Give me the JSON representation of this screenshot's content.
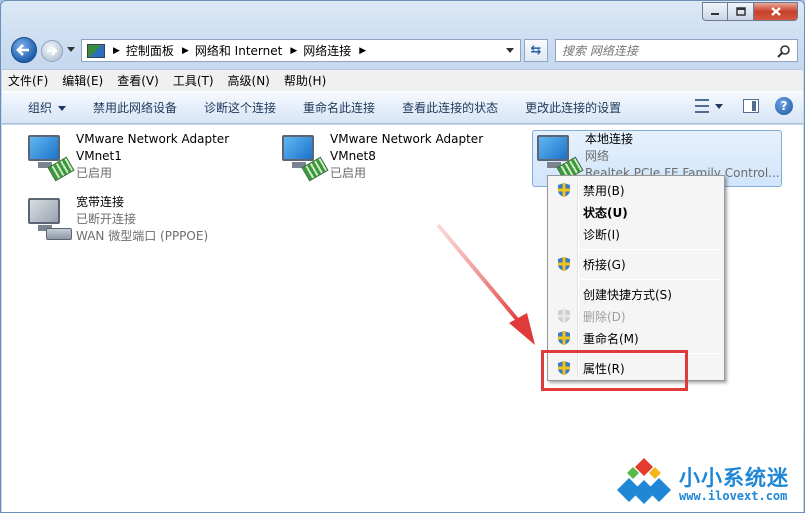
{
  "window": {
    "caption_buttons": [
      "minimize-icon",
      "maximize-icon",
      "close-icon"
    ]
  },
  "address": {
    "crumbs": [
      "控制面板",
      "网络和 Internet",
      "网络连接"
    ]
  },
  "search": {
    "placeholder": "搜索 网络连接"
  },
  "menubar": [
    "文件(F)",
    "编辑(E)",
    "查看(V)",
    "工具(T)",
    "高级(N)",
    "帮助(H)"
  ],
  "commands": {
    "organize": "组织",
    "disable": "禁用此网络设备",
    "diagnose": "诊断这个连接",
    "rename": "重命名此连接",
    "status": "查看此连接的状态",
    "settings": "更改此连接的设置"
  },
  "connections": [
    {
      "name": "VMware Network Adapter",
      "line2": "VMnet1",
      "line3": "已启用",
      "icon": "network-adapter-icon"
    },
    {
      "name": "VMware Network Adapter",
      "line2": "VMnet8",
      "line3": "已启用",
      "icon": "network-adapter-icon"
    },
    {
      "name": "本地连接",
      "line2": "网络",
      "line3": "Realtek PCIe FE Family Control...",
      "icon": "network-adapter-icon",
      "selected": true
    },
    {
      "name": "宽带连接",
      "line2": "已断开连接",
      "line3": "WAN 微型端口 (PPPOE)",
      "icon": "broadband-modem-icon"
    }
  ],
  "context_menu": [
    {
      "label": "禁用(B)",
      "shield": true
    },
    {
      "label": "状态(U)",
      "bold": true
    },
    {
      "label": "诊断(I)"
    },
    {
      "label": "桥接(G)",
      "shield": true
    },
    {
      "label": "创建快捷方式(S)"
    },
    {
      "label": "删除(D)",
      "shield": true,
      "disabled": true
    },
    {
      "label": "重命名(M)",
      "shield": true
    },
    {
      "label": "属性(R)",
      "shield": true,
      "highlighted_by_annotation": true
    }
  ],
  "watermark": {
    "name": "小小系统迷",
    "url": "www.ilovext.com"
  },
  "colors": {
    "annotation_red": "#e03a3a",
    "selection_border": "#84acdd",
    "brand_blue": "#2087d6"
  }
}
